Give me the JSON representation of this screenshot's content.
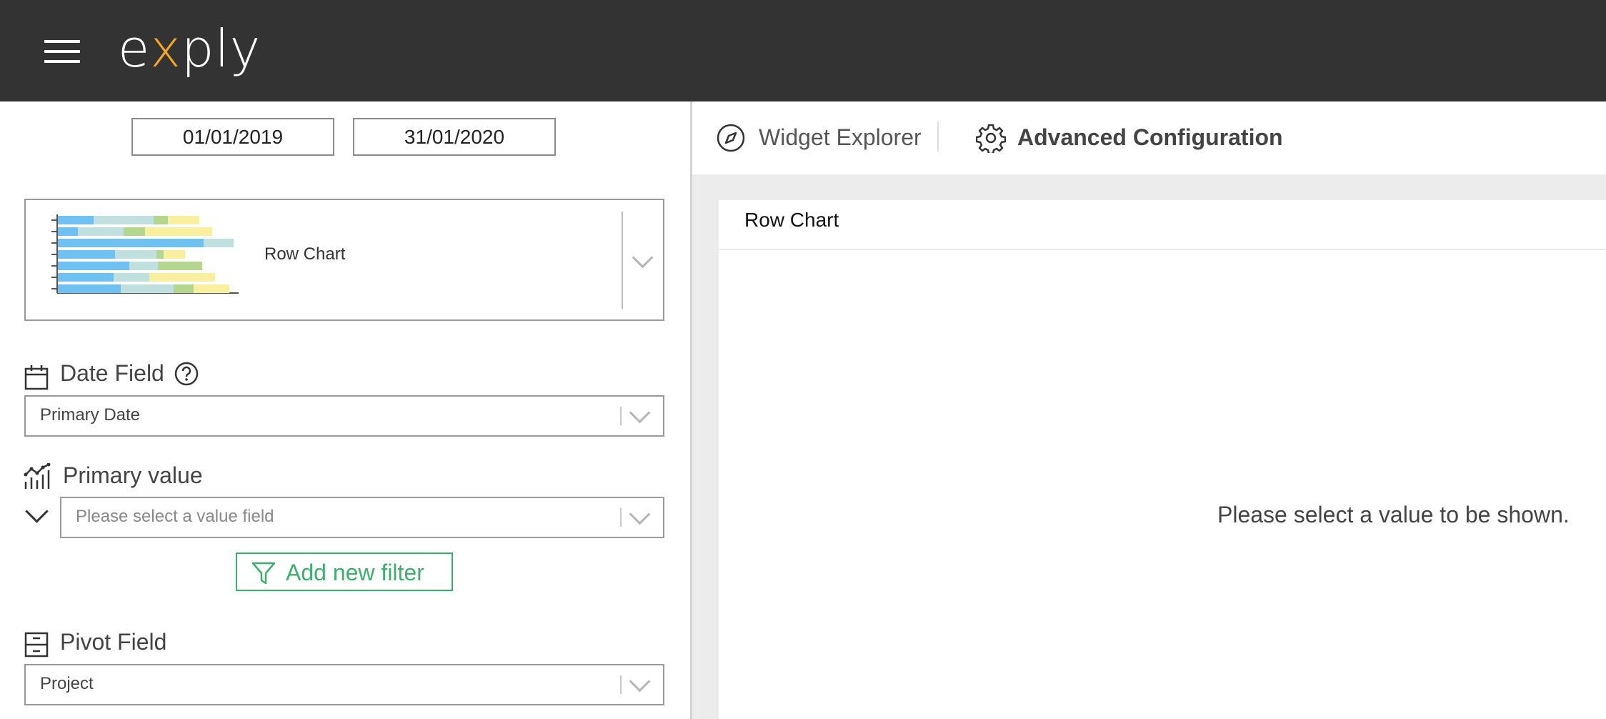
{
  "header": {
    "logo_prefix": "e",
    "logo_x": "x",
    "logo_suffix": "ply"
  },
  "date_range": {
    "start": "01/01/2019",
    "end": "31/01/2020"
  },
  "chart_type": {
    "selected": "Row Chart",
    "thumbnail_icon": "row-chart-thumbnail"
  },
  "date_field": {
    "label": "Date Field",
    "value": "Primary Date"
  },
  "primary_value": {
    "label": "Primary value",
    "placeholder": "Please select a value field"
  },
  "add_filter": {
    "label": "Add new filter"
  },
  "pivot_field": {
    "label": "Pivot Field",
    "value": "Project"
  },
  "tabs": {
    "widget_explorer": "Widget Explorer",
    "advanced_configuration": "Advanced Configuration"
  },
  "widget": {
    "title": "Row Chart",
    "empty_message": "Please select a value to be shown."
  },
  "colors": {
    "topbar": "#333333",
    "accent": "#f5a623",
    "filter_green": "#3ab06a"
  }
}
